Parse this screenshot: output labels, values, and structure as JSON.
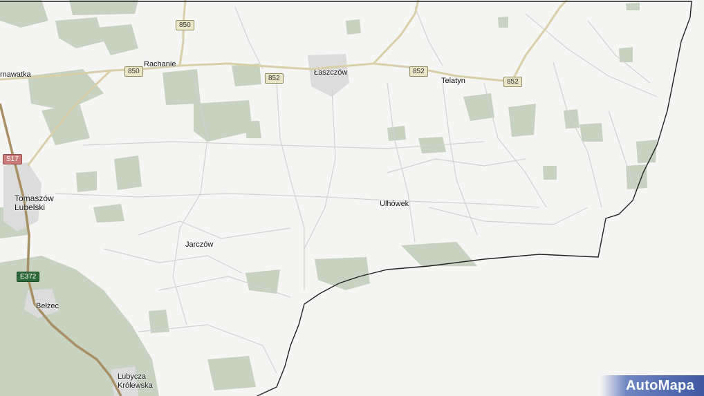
{
  "map": {
    "places": [
      {
        "id": "rachanie",
        "name": "Rachanie"
      },
      {
        "id": "laszczow",
        "name": "Łaszczów"
      },
      {
        "id": "telatyn",
        "name": "Telatyn"
      },
      {
        "id": "tarnawatka",
        "name": "rnawatka"
      },
      {
        "id": "tomaszow",
        "name": "Tomaszów Lubelski"
      },
      {
        "id": "ulhowek",
        "name": "Ulhówek"
      },
      {
        "id": "jarczow",
        "name": "Jarczów"
      },
      {
        "id": "belzec",
        "name": "Bełżec"
      },
      {
        "id": "lubycza",
        "name": "Lubycza Królewska"
      }
    ],
    "road_labels": [
      {
        "id": "r850a",
        "ref": "850"
      },
      {
        "id": "r850b",
        "ref": "850"
      },
      {
        "id": "r852a",
        "ref": "852"
      },
      {
        "id": "r852b",
        "ref": "852"
      },
      {
        "id": "r852c",
        "ref": "852"
      },
      {
        "id": "s17",
        "ref": "S17"
      },
      {
        "id": "e372",
        "ref": "E372"
      }
    ]
  },
  "brand": {
    "logo_text": "AutoMapa"
  },
  "colors": {
    "forest": "#c9d3c2",
    "road_main": "#d8cfb0",
    "road_minor": "#cfcfcf",
    "expressway": "#a98f66",
    "border": "#222222",
    "brand": "#3e58a2"
  }
}
